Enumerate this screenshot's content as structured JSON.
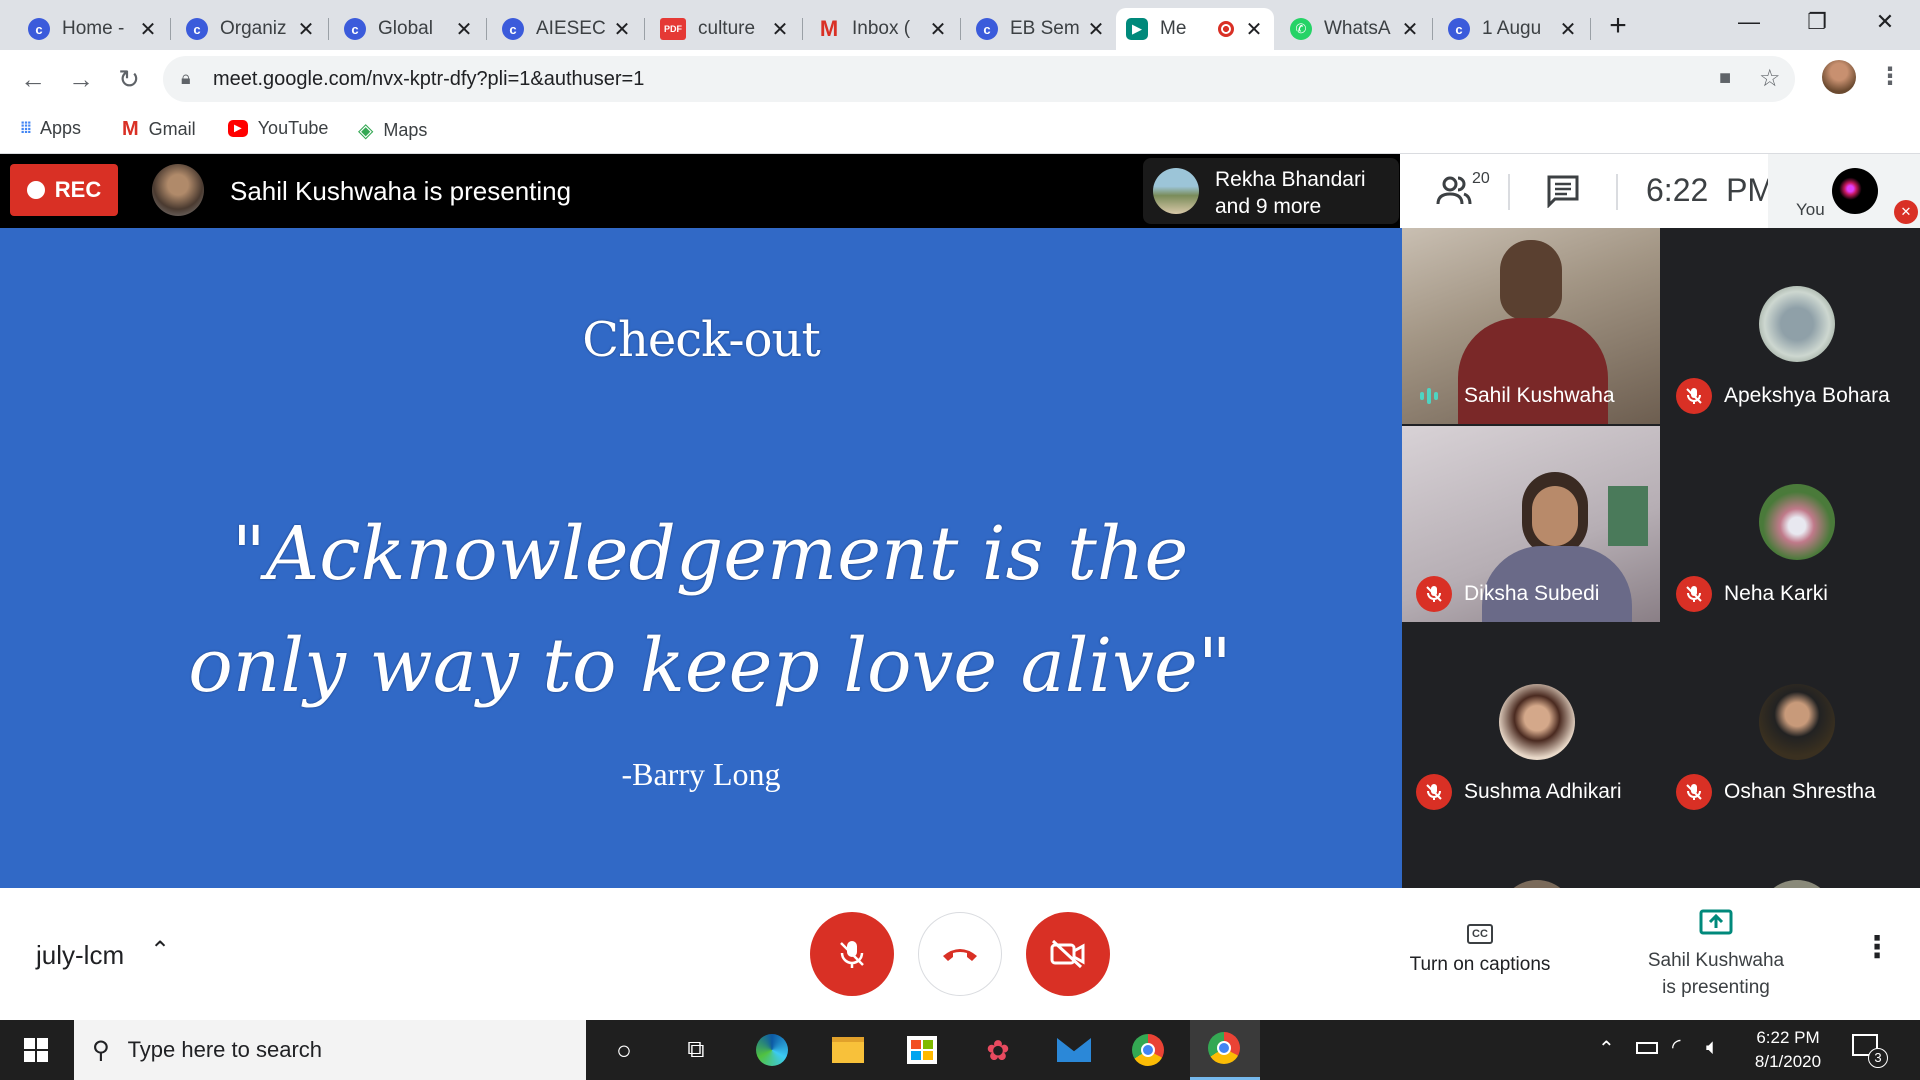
{
  "browser": {
    "tabs": [
      {
        "title": "Home -",
        "icon": "c-icon"
      },
      {
        "title": "Organiz",
        "icon": "c-icon"
      },
      {
        "title": "Global",
        "icon": "c-icon"
      },
      {
        "title": "AIESEC",
        "icon": "c-icon"
      },
      {
        "title": "culture",
        "icon": "pdf-icon"
      },
      {
        "title": "Inbox (",
        "icon": "gmail-icon"
      },
      {
        "title": "EB Sem",
        "icon": "c-icon"
      },
      {
        "title": "Me",
        "icon": "meet-icon"
      },
      {
        "title": "WhatsA",
        "icon": "whatsapp-icon"
      },
      {
        "title": "1 Augu",
        "icon": "c-icon"
      }
    ],
    "pdf_badge": "PDF",
    "url": "meet.google.com/nvx-kptr-dfy?pli=1&authuser=1",
    "bookmarks": [
      "Apps",
      "Gmail",
      "YouTube",
      "Maps"
    ]
  },
  "meet": {
    "rec_label": "REC",
    "presenting_text": "Sahil Kushwaha is presenting",
    "others_line1": "Rekha Bhandari",
    "others_line2": "and 9 more",
    "participant_count": "20",
    "time": "6:22  PM",
    "you_label": "You",
    "meeting_name": "july-lcm",
    "captions_label": "Turn on captions",
    "presenting_line1": "Sahil Kushwaha",
    "presenting_line2": "is presenting"
  },
  "slide": {
    "title": "Check-out",
    "quote": "\"Acknowledgement is the only way to keep love alive\"",
    "author": "-Barry Long"
  },
  "participants": [
    {
      "name": "Sahil Kushwaha",
      "video": true,
      "speaking": true
    },
    {
      "name": "Apekshya Bohara",
      "video": false,
      "muted": true
    },
    {
      "name": "Diksha Subedi",
      "video": true,
      "muted": true
    },
    {
      "name": "Neha Karki",
      "video": false,
      "muted": true
    },
    {
      "name": "Sushma Adhikari",
      "video": false,
      "muted": true
    },
    {
      "name": "Oshan Shrestha",
      "video": false,
      "muted": true
    }
  ],
  "taskbar": {
    "search_placeholder": "Type here to search",
    "time": "6:22 PM",
    "date": "8/1/2020",
    "notification_count": "3"
  },
  "colors": {
    "accent_red": "#d93025",
    "slide_blue": "#3169c6",
    "meet_dark": "#202124"
  }
}
